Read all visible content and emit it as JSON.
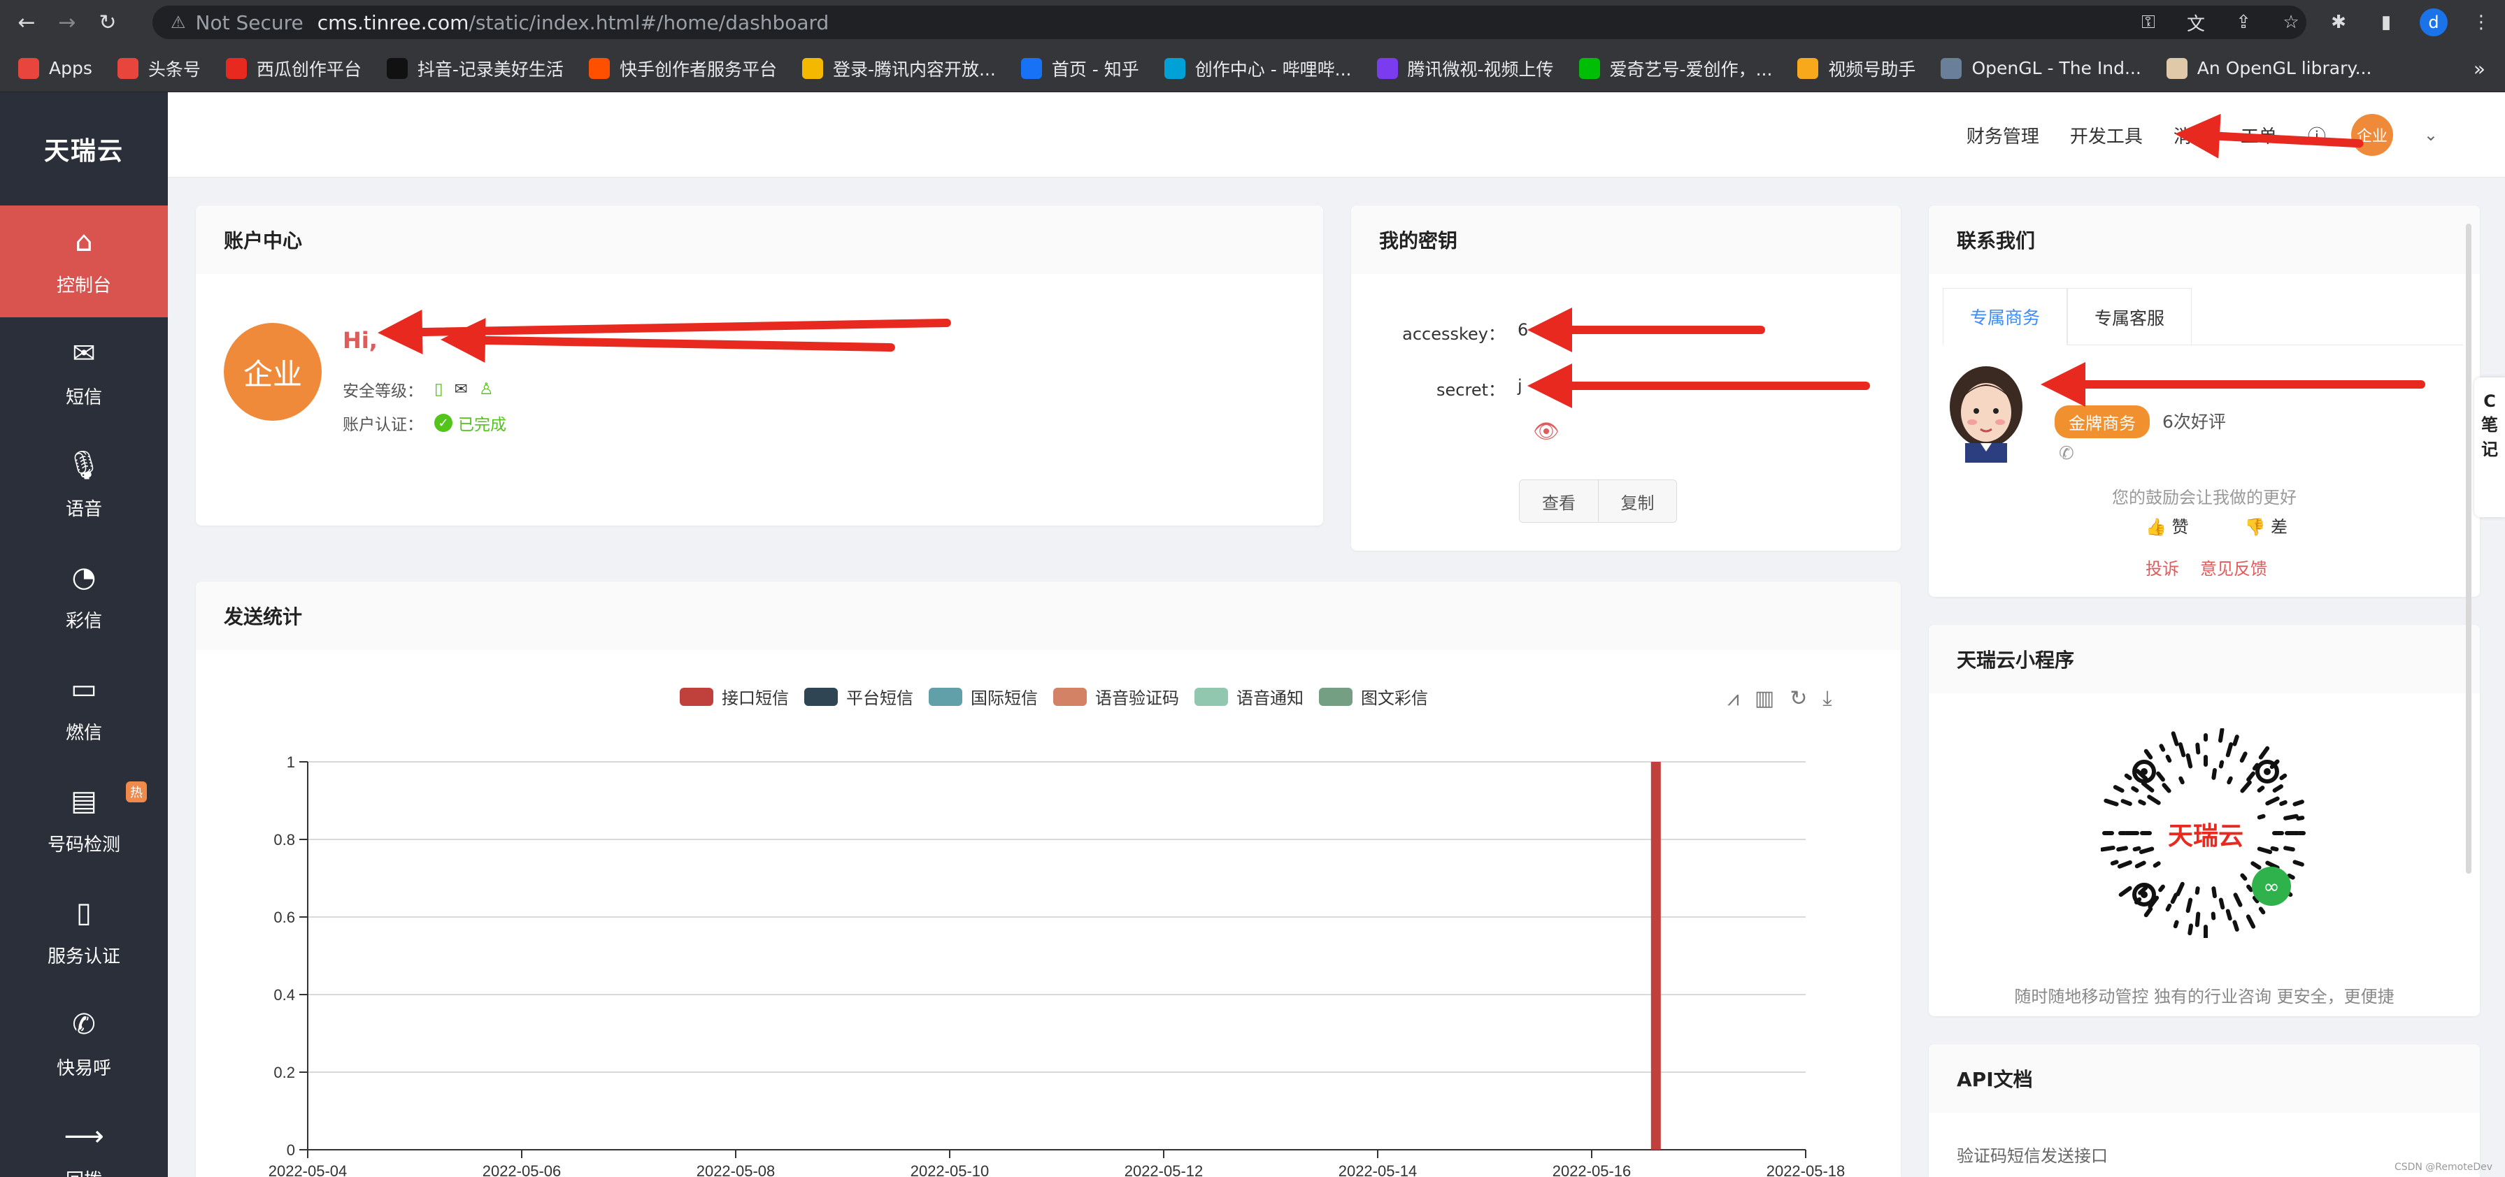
{
  "browser": {
    "security": "Not Secure",
    "url_host": "cms.tinree.com",
    "url_path": "/static/index.html#/home/dashboard",
    "profile_initial": "d"
  },
  "bookmarks": [
    {
      "label": "Apps",
      "color": "#e8453c"
    },
    {
      "label": "头条号",
      "color": "#e8453c"
    },
    {
      "label": "西瓜创作平台",
      "color": "#e8291f"
    },
    {
      "label": "抖音-记录美好生活",
      "color": "#111111"
    },
    {
      "label": "快手创作者服务平台",
      "color": "#ff5000"
    },
    {
      "label": "登录-腾讯内容开放...",
      "color": "#f5b800"
    },
    {
      "label": "首页 - 知乎",
      "color": "#1772f6"
    },
    {
      "label": "创作中心 - 哔哩哔...",
      "color": "#00a1d6"
    },
    {
      "label": "腾讯微视-视频上传",
      "color": "#7b3cf0"
    },
    {
      "label": "爱奇艺号-爱创作，...",
      "color": "#00be06"
    },
    {
      "label": "视频号助手",
      "color": "#f7a81b"
    },
    {
      "label": "OpenGL - The Ind...",
      "color": "#6a7f99"
    },
    {
      "label": "An OpenGL library...",
      "color": "#e0c9a8"
    }
  ],
  "sidebar": {
    "logo": "天瑞云",
    "items": [
      {
        "label": "控制台",
        "icon": "⌂"
      },
      {
        "label": "短信",
        "icon": "✉"
      },
      {
        "label": "语音",
        "icon": "🎙"
      },
      {
        "label": "彩信",
        "icon": "◔"
      },
      {
        "label": "燃信",
        "icon": "▭"
      },
      {
        "label": "号码检测",
        "icon": "▤",
        "badge": "热"
      },
      {
        "label": "服务认证",
        "icon": "▯"
      },
      {
        "label": "快易呼",
        "icon": "✆"
      },
      {
        "label": "回拨",
        "icon": "⟶"
      }
    ]
  },
  "topbar": {
    "links": [
      "财务管理",
      "开发工具",
      "消息",
      "工单",
      "ⓘ"
    ],
    "avatar": "企业"
  },
  "account": {
    "title": "账户中心",
    "avatar": "企业",
    "greeting": "Hi,",
    "security_label": "安全等级：",
    "auth_label": "账户认证：",
    "auth_status": "已完成"
  },
  "keys": {
    "title": "我的密钥",
    "accesskey_label": "accesskey：",
    "accesskey_value": "6",
    "secret_label": "secret：",
    "secret_value": "j",
    "view_button": "查看",
    "copy_button": "复制"
  },
  "contact": {
    "title": "联系我们",
    "tabs": [
      "专属商务",
      "专属客服"
    ],
    "badge": "金牌商务",
    "praise": "6次好评",
    "encourage": "您的鼓励会让我做的更好",
    "like": "赞",
    "dislike": "差",
    "complaint": "投诉",
    "feedback": "意见反馈"
  },
  "mini_program": {
    "title": "天瑞云小程序",
    "qr_brand": "天瑞云",
    "caption": "随时随地移动管控 独有的行业咨询 更安全，更便捷"
  },
  "api_docs": {
    "title": "API文档",
    "link": "验证码短信发送接口"
  },
  "stats": {
    "title": "发送统计"
  },
  "side_widget": [
    "C",
    "笔",
    "记"
  ],
  "watermark": "CSDN @RemoteDev",
  "chart_data": {
    "type": "bar",
    "series": [
      {
        "name": "接口短信",
        "color": "#c0413b"
      },
      {
        "name": "平台短信",
        "color": "#2f4554"
      },
      {
        "name": "国际短信",
        "color": "#61a0a8"
      },
      {
        "name": "语音验证码",
        "color": "#d48265"
      },
      {
        "name": "语音通知",
        "color": "#91c7ae"
      },
      {
        "name": "图文彩信",
        "color": "#749f83"
      }
    ],
    "x_ticks": [
      "2022-05-04",
      "2022-05-06",
      "2022-05-08",
      "2022-05-10",
      "2022-05-12",
      "2022-05-14",
      "2022-05-16",
      "2022-05-18"
    ],
    "y_ticks": [
      "0",
      "0.2",
      "0.4",
      "0.6",
      "0.8",
      "1"
    ],
    "ylim": [
      0,
      1
    ],
    "xlim": [
      "2022-05-04",
      "2022-05-18"
    ],
    "bars": [
      {
        "date": "2022-05-16",
        "series": "接口短信",
        "value": 1
      }
    ]
  }
}
